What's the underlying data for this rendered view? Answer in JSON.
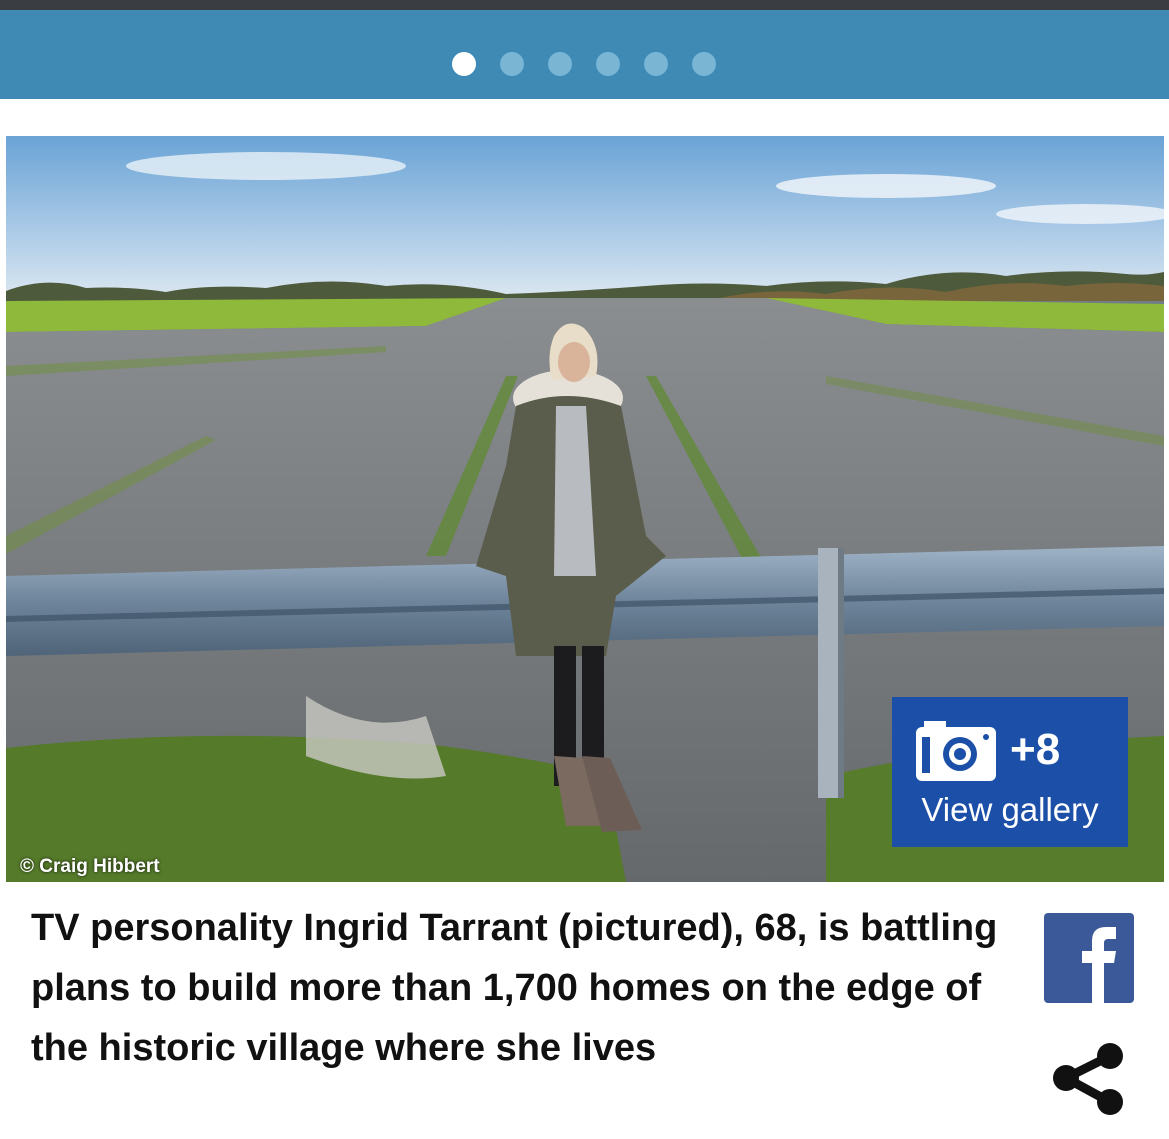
{
  "carousel": {
    "slide_count": 6,
    "active_index": 0,
    "colors": {
      "bar": "#3f8ab5",
      "active_dot": "#ffffff",
      "inactive_dot": "#7ab5d3"
    }
  },
  "photo": {
    "credit": "© Craig Hibbert",
    "gallery_button": {
      "count_label": "+8",
      "label": "View gallery",
      "icon": "camera-icon",
      "color": "#1c4fa8"
    }
  },
  "caption": {
    "text": "TV personality Ingrid Tarrant (pictured), 68, is battling plans to build more than 1,700 homes on the edge of the historic village where she lives"
  },
  "share": {
    "facebook_icon": "facebook-icon",
    "facebook_color": "#3b5998",
    "share_icon": "share-icon"
  }
}
